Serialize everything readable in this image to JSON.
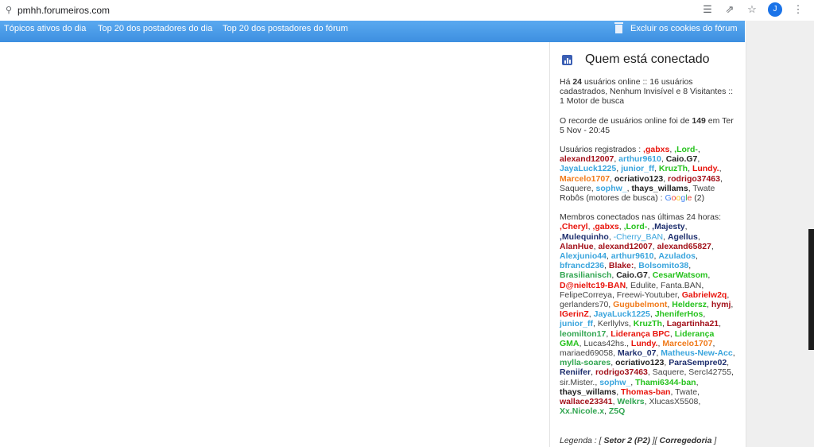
{
  "browser": {
    "url": "pmhh.forumeiros.com",
    "lock_icon": "lock-icon",
    "avatar_letter": "J"
  },
  "nav": {
    "items": [
      "Tópicos ativos do dia",
      "Top 20 dos postadores do dia",
      "Top 20 dos postadores do fórum"
    ],
    "cookies": "Excluir os cookies do fórum"
  },
  "panel": {
    "title": "Quem está conectado",
    "online": {
      "pre": "Há ",
      "count": "24",
      "post": " usuários online :: 16 usuários cadastrados, Nenhum Invisível e 8 Visitantes :: 1 Motor de busca"
    },
    "record": {
      "pre": "O recorde de usuários online foi de ",
      "count": "149",
      "post": " em Ter 5 Nov - 20:45"
    },
    "registered_label": "Usuários registrados : ",
    "registered": [
      {
        "n": ",gabxs",
        "c": "#e8140c",
        "b": true
      },
      {
        "n": ",Lord-",
        "c": "#26c21d",
        "b": true
      },
      {
        "n": "alexand12007",
        "c": "#a3121b",
        "b": true
      },
      {
        "n": "arthur9610",
        "c": "#3aa5dd",
        "b": true
      },
      {
        "n": "Caio.G7",
        "c": "#222222",
        "b": true
      },
      {
        "n": "JayaLuck1225",
        "c": "#3aa5dd",
        "b": true
      },
      {
        "n": "junior_ff",
        "c": "#3aa5dd",
        "b": true
      },
      {
        "n": "KruzTh",
        "c": "#26c21d",
        "b": true
      },
      {
        "n": "Lundy.",
        "c": "#e8140c",
        "b": true
      },
      {
        "n": "Marcelo1707",
        "c": "#f07a1a",
        "b": true
      },
      {
        "n": "ocriativo123",
        "c": "#222222",
        "b": true
      },
      {
        "n": "rodrigo37463",
        "c": "#a3121b",
        "b": true
      },
      {
        "n": "Saquere",
        "c": "#444444",
        "b": false
      },
      {
        "n": "sophw_",
        "c": "#3aa5dd",
        "b": true
      },
      {
        "n": "thays_willams",
        "c": "#222222",
        "b": true
      },
      {
        "n": "Twate",
        "c": "#444444",
        "b": false
      }
    ],
    "robots": {
      "label": "Robôs (motores de busca) : ",
      "suffix": " (2)"
    },
    "google": {
      "g1": "G",
      "g2": "o",
      "g3": "o",
      "g4": "g",
      "g5": "l",
      "g6": "e"
    },
    "members_label": "Membros conectados nas últimas 24 horas: ",
    "members": [
      {
        "n": ",Cheryl",
        "c": "#e8140c",
        "b": true
      },
      {
        "n": ",gabxs",
        "c": "#e8140c",
        "b": true
      },
      {
        "n": ",Lord-",
        "c": "#26c21d",
        "b": true
      },
      {
        "n": ",Majesty",
        "c": "#1e2f6e",
        "b": true
      },
      {
        "n": ",Mulequinho",
        "c": "#1e2f6e",
        "b": true
      },
      {
        "n": "-Cherry_BAN",
        "c": "#3aa5dd",
        "b": false
      },
      {
        "n": "Agellus",
        "c": "#1e2f6e",
        "b": true
      },
      {
        "n": "AlanHue",
        "c": "#a3121b",
        "b": true
      },
      {
        "n": "alexand12007",
        "c": "#a3121b",
        "b": true
      },
      {
        "n": "alexand65827",
        "c": "#a3121b",
        "b": true
      },
      {
        "n": "Alexjunio44",
        "c": "#3aa5dd",
        "b": true
      },
      {
        "n": "arthur9610",
        "c": "#3aa5dd",
        "b": true
      },
      {
        "n": "Azulados",
        "c": "#3aa5dd",
        "b": true
      },
      {
        "n": "bfrancd236",
        "c": "#3aa5dd",
        "b": true
      },
      {
        "n": "Blake:",
        "c": "#a3121b",
        "b": true
      },
      {
        "n": "Bolsomito38",
        "c": "#3aa5dd",
        "b": true
      },
      {
        "n": "Brasilianisch",
        "c": "#33a652",
        "b": true
      },
      {
        "n": "Caio.G7",
        "c": "#222222",
        "b": true
      },
      {
        "n": "CesarWatsom",
        "c": "#26c21d",
        "b": true
      },
      {
        "n": "D@nieltc19-BAN",
        "c": "#e8140c",
        "b": true
      },
      {
        "n": "Edulite",
        "c": "#444444",
        "b": false
      },
      {
        "n": "Fanta.BAN",
        "c": "#444444",
        "b": false
      },
      {
        "n": "FelipeCorreya",
        "c": "#444444",
        "b": false
      },
      {
        "n": "Freewi-Youtuber",
        "c": "#444444",
        "b": false
      },
      {
        "n": "Gabrielw2q",
        "c": "#e8140c",
        "b": true
      },
      {
        "n": "gerlanders70",
        "c": "#444444",
        "b": false
      },
      {
        "n": "Gugubelmont",
        "c": "#f07a1a",
        "b": true
      },
      {
        "n": "Heldersz",
        "c": "#26c21d",
        "b": true
      },
      {
        "n": "hymj",
        "c": "#a3121b",
        "b": true
      },
      {
        "n": "IGerinZ",
        "c": "#e8140c",
        "b": true
      },
      {
        "n": "JayaLuck1225",
        "c": "#3aa5dd",
        "b": true
      },
      {
        "n": "JheniferHos",
        "c": "#26c21d",
        "b": true
      },
      {
        "n": "junior_ff",
        "c": "#3aa5dd",
        "b": true
      },
      {
        "n": "Kerllylvs",
        "c": "#444444",
        "b": false
      },
      {
        "n": "KruzTh",
        "c": "#26c21d",
        "b": true
      },
      {
        "n": "Lagartinha21",
        "c": "#a3121b",
        "b": true
      },
      {
        "n": "leomilton17",
        "c": "#33a652",
        "b": true
      },
      {
        "n": "Liderança BPC",
        "c": "#e8140c",
        "b": true
      },
      {
        "n": "Liderança GMA",
        "c": "#26c21d",
        "b": true
      },
      {
        "n": "Lucas42hs.",
        "c": "#444444",
        "b": false
      },
      {
        "n": "Lundy.",
        "c": "#e8140c",
        "b": true
      },
      {
        "n": "Marcelo1707",
        "c": "#f07a1a",
        "b": true
      },
      {
        "n": "mariaed69058",
        "c": "#444444",
        "b": false
      },
      {
        "n": "Marko_07",
        "c": "#1e2f6e",
        "b": true
      },
      {
        "n": "Matheus-New-Acc",
        "c": "#3aa5dd",
        "b": true
      },
      {
        "n": "mylla-soares",
        "c": "#33a652",
        "b": true
      },
      {
        "n": "ocriativo123",
        "c": "#222222",
        "b": true
      },
      {
        "n": "ParaSempre02",
        "c": "#1e2f6e",
        "b": true
      },
      {
        "n": "Reniifer",
        "c": "#1e2f6e",
        "b": true
      },
      {
        "n": "rodrigo37463",
        "c": "#a3121b",
        "b": true
      },
      {
        "n": "Saquere",
        "c": "#444444",
        "b": false
      },
      {
        "n": "SercI42755",
        "c": "#444444",
        "b": false
      },
      {
        "n": "sir.Mister.",
        "c": "#444444",
        "b": false
      },
      {
        "n": "sophw_",
        "c": "#3aa5dd",
        "b": true
      },
      {
        "n": "Thami6344-ban",
        "c": "#26c21d",
        "b": true
      },
      {
        "n": "thays_willams",
        "c": "#222222",
        "b": true
      },
      {
        "n": "Thomas-ban",
        "c": "#e8140c",
        "b": true
      },
      {
        "n": "Twate",
        "c": "#444444",
        "b": false
      },
      {
        "n": "wallace23341",
        "c": "#a3121b",
        "b": true
      },
      {
        "n": "Welkrs",
        "c": "#33a652",
        "b": true
      },
      {
        "n": "XlucasX5508",
        "c": "#444444",
        "b": false
      },
      {
        "n": "Xx.Nicole.x",
        "c": "#33a652",
        "b": true
      },
      {
        "n": "Z5Q",
        "c": "#33a652",
        "b": true
      }
    ],
    "legend": {
      "label": "Legenda : [ ",
      "item1": "Setor 2 (P2)",
      "sep": " ][ ",
      "item2": "Corregedoria",
      "end": " ]"
    }
  }
}
